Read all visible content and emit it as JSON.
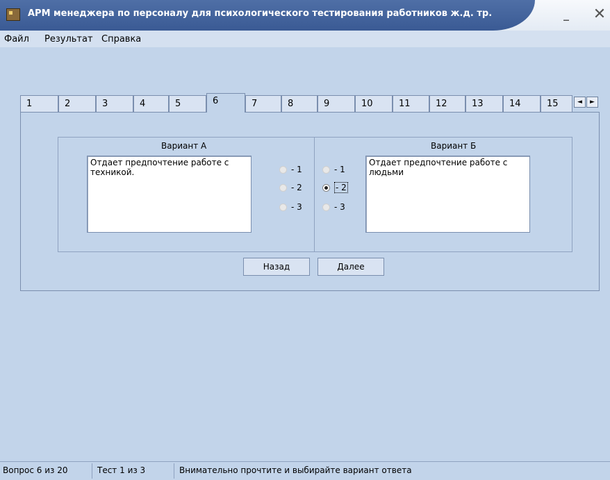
{
  "window": {
    "title": "АРМ менеджера по персоналу для психологического тестирования работников ж.д. тр.",
    "minimize": "_",
    "close": "✕"
  },
  "menu": [
    "Файл",
    "Результат",
    "Справка"
  ],
  "tabs": [
    "1",
    "2",
    "3",
    "4",
    "5",
    "6",
    "7",
    "8",
    "9",
    "10",
    "11",
    "12",
    "13",
    "14",
    "15"
  ],
  "active_tab": "6",
  "tab_scroll": {
    "left": "◄",
    "right": "►"
  },
  "question": {
    "variant_a": {
      "label": "Вариант А",
      "text": "Отдает предпочтение работе с техникой."
    },
    "variant_b": {
      "label": "Вариант Б",
      "text": "Отдает предпочтение работе с людьми"
    },
    "options_a": [
      "- 1",
      "- 2",
      "- 3"
    ],
    "options_b": [
      "- 1",
      "- 2",
      "- 3"
    ],
    "selected": {
      "group": "b",
      "option": "- 2"
    }
  },
  "buttons": {
    "back": "Назад",
    "next": "Далее"
  },
  "status": {
    "question": "Вопрос 6 из 20",
    "test": "Тест 1 из 3",
    "hint": "Внимательно прочтите и выбирайте вариант ответа"
  }
}
